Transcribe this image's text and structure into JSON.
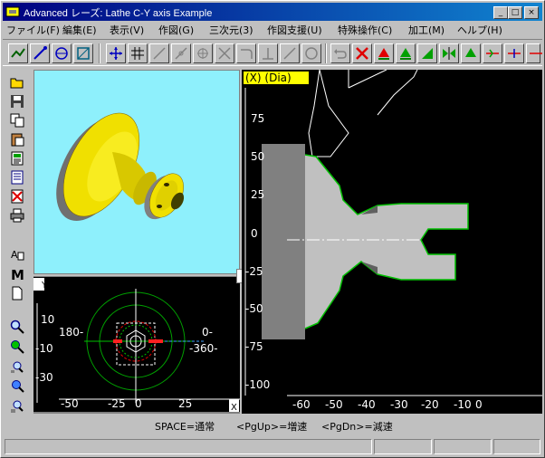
{
  "window": {
    "title": "Advanced レーズ: Lathe C-Y axis Example"
  },
  "title_buttons": {
    "minimize": "_",
    "maximize": "□",
    "close": "×"
  },
  "menu": [
    "ファイル(F)",
    "編集(E)",
    "表示(V)",
    "作図(G)",
    "三次元(3)",
    "作図支援(U)",
    "特殊操作(C)",
    "加工(M)",
    "ヘルプ(H)"
  ],
  "side_view": {
    "label": "(X) (Dia)",
    "y_ticks": [
      "75",
      "50",
      "25",
      "0",
      "-25",
      "-50",
      "-75",
      "-100"
    ],
    "x_ticks": [
      "-60",
      "-50",
      "-40",
      "-30",
      "-20",
      "-10",
      "0"
    ]
  },
  "top_view": {
    "y_label": "Y",
    "x_label": "X",
    "y_ticks": [
      "10",
      "-10",
      "-30"
    ],
    "x_ticks": [
      "-50",
      "-25",
      "0",
      "25"
    ],
    "angle_left": "180-",
    "angle_right_top": "0-",
    "angle_right_bottom": "-360-"
  },
  "status": {
    "space": "SPACE=通常",
    "pgup": "<PgUp>=増速",
    "pgdn": "<PgDn>=減速"
  },
  "colors": {
    "titlebar": "#000080",
    "view3d_bg": "#8ef0fc",
    "part": "#f0e000",
    "dim": "#909090"
  }
}
